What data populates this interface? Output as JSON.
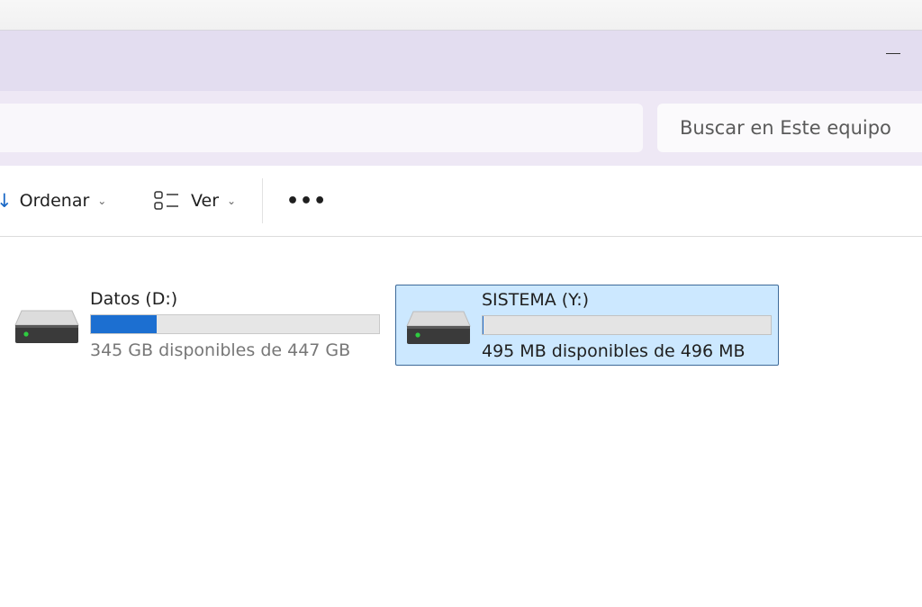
{
  "titlebar": {
    "minimize_label": "—"
  },
  "search": {
    "placeholder": "Buscar en Este equipo"
  },
  "toolbar": {
    "sort_label": "Ordenar",
    "view_label": "Ver",
    "more_label": "•••",
    "sort_icon": "sort-down-arrow-icon",
    "view_icon": "view-layout-icon",
    "chevron_icon": "chevron-down-icon"
  },
  "drives": [
    {
      "name": "Datos (D:)",
      "info": "345 GB disponibles de 447 GB",
      "used_fraction": 0.228,
      "selected": false,
      "icon": "hard-drive-icon"
    },
    {
      "name": "SISTEMA (Y:)",
      "info": "495 MB disponibles de 496 MB",
      "used_fraction": 0.002,
      "selected": true,
      "icon": "hard-drive-icon"
    }
  ],
  "colors": {
    "titlebar_bg": "#e3ddf0",
    "addressbar_bg": "#eee8f5",
    "selection_bg": "#cce8ff",
    "selection_border": "#3d6a99",
    "bar_fill": "#1c6fd1"
  }
}
